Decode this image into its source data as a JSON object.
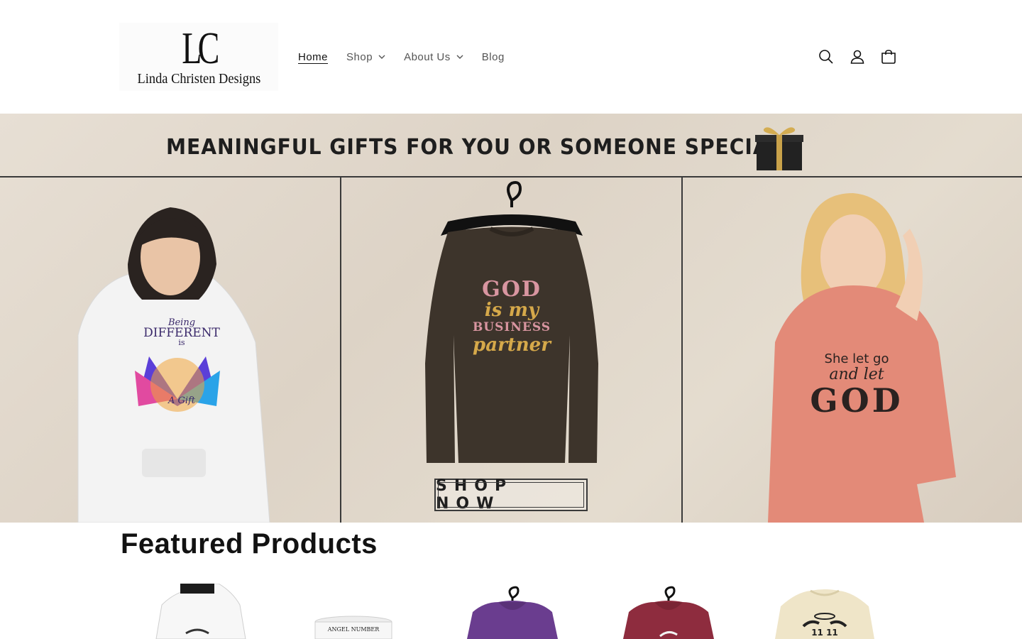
{
  "brand": {
    "logo_mark": "LC",
    "logo_name": "Linda Christen Designs"
  },
  "nav": {
    "items": [
      {
        "label": "Home",
        "active": true,
        "dropdown": false
      },
      {
        "label": "Shop",
        "active": false,
        "dropdown": true
      },
      {
        "label": "About Us",
        "active": false,
        "dropdown": true
      },
      {
        "label": "Blog",
        "active": false,
        "dropdown": false
      }
    ]
  },
  "header_icons": [
    "search-icon",
    "account-icon",
    "cart-icon"
  ],
  "banner": {
    "headline": "MEANINGFUL GIFTS FOR YOU OR SOMEONE SPECIAL",
    "cta": "SHOP NOW",
    "shirts": {
      "left": {
        "line1": "Being",
        "line2": "DIFFERENT",
        "line3": "is",
        "line4": "A Gift"
      },
      "center": {
        "line1": "GOD",
        "line2": "is my",
        "line3": "BUSINESS",
        "line4": "partner"
      },
      "right": {
        "line1": "She let go",
        "line2": "and let",
        "line3": "GOD"
      }
    }
  },
  "featured": {
    "title": "Featured Products",
    "products": [
      {
        "label": "white-hoodie-angel"
      },
      {
        "label": "angel-number-mug",
        "text": "ANGEL NUMBER"
      },
      {
        "label": "purple-hoodie"
      },
      {
        "label": "maroon-hoodie"
      },
      {
        "label": "cream-sweatshirt-1111",
        "text": "11 11"
      }
    ]
  },
  "colors": {
    "accent_text": "#121212",
    "nav_text": "#555555",
    "banner_bg": "#e2d9cd",
    "pink_sweater": "#e38a78",
    "brown_sweater": "#3d342b",
    "purple_hoodie": "#6a3d8f",
    "maroon_hoodie": "#8e2c3e"
  }
}
